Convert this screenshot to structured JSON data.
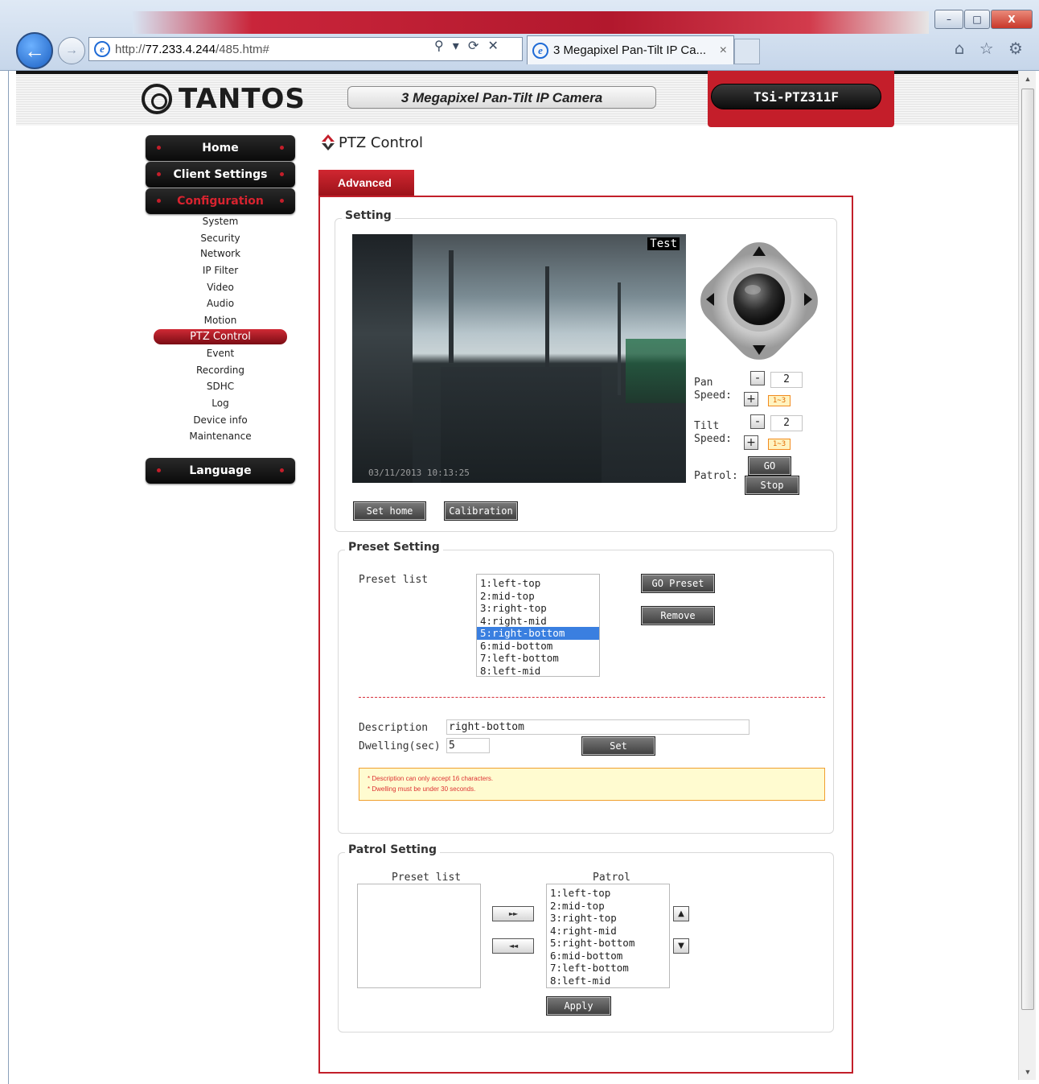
{
  "browser": {
    "url_prefix": "http://",
    "url_host": "77.233.4.244",
    "url_path": "/485.htm#",
    "tab_title": "3 Megapixel Pan-Tilt IP Ca...",
    "tab_close": "×",
    "search_icon": "⚲ ▾",
    "refresh_icon": "⟳",
    "stop_icon": "✕",
    "window_minimize": "–",
    "window_maximize": "□",
    "window_close": "X",
    "right_icons": "⌂ ☆ ⚙"
  },
  "header": {
    "brand": "TANTOS",
    "camera_title": "3 Megapixel Pan-Tilt IP Camera",
    "model": "TSi-PTZ311F"
  },
  "nav": {
    "home": "Home",
    "client_settings": "Client Settings",
    "configuration": "Configuration",
    "language": "Language",
    "sub_items": [
      "System",
      "Security",
      "Network",
      "IP Filter",
      "Video",
      "Audio",
      "Motion",
      "PTZ Control",
      "Event",
      "Recording",
      "SDHC",
      "Log",
      "Device info",
      "Maintenance"
    ],
    "active_item": "PTZ Control"
  },
  "page": {
    "title": "PTZ Control",
    "tab_label": "Advanced"
  },
  "setting": {
    "legend": "Setting",
    "video_label": "Test",
    "video_timestamp": "03/11/2013  10:13:25",
    "pan_label_1": "Pan",
    "pan_label_2": "Speed:",
    "pan_value": "2",
    "tilt_label_1": "Tilt",
    "tilt_label_2": "Speed:",
    "tilt_value": "2",
    "speed_range": "1~3",
    "minus": "-",
    "plus": "+",
    "patrol_label": "Patrol:",
    "go_button": "GO",
    "stop_button": "Stop",
    "set_home_button": "Set home",
    "calibration_button": "Calibration"
  },
  "preset": {
    "legend": "Preset Setting",
    "list_label": "Preset list",
    "items": [
      "1:left-top",
      "2:mid-top",
      "3:right-top",
      "4:right-mid",
      "5:right-bottom",
      "6:mid-bottom",
      "7:left-bottom",
      "8:left-mid"
    ],
    "selected_index": 4,
    "go_preset_button": "GO Preset",
    "remove_button": "Remove",
    "description_label": "Description",
    "description_value": "right-bottom",
    "dwelling_label": "Dwelling(sec)",
    "dwelling_value": "5",
    "set_button": "Set",
    "notes": [
      "* Description can only accept 16 characters.",
      "* Dwelling must be under 30 seconds."
    ]
  },
  "patrol": {
    "legend": "Patrol Setting",
    "preset_list_header": "Preset list",
    "patrol_header": "Patrol",
    "preset_items": [],
    "patrol_items": [
      "1:left-top",
      "2:mid-top",
      "3:right-top",
      "4:right-mid",
      "5:right-bottom",
      "6:mid-bottom",
      "7:left-bottom",
      "8:left-mid"
    ],
    "add_button": "►►",
    "remove_button": "◄◄",
    "up_button": "▲",
    "down_button": "▼",
    "apply_button": "Apply"
  }
}
